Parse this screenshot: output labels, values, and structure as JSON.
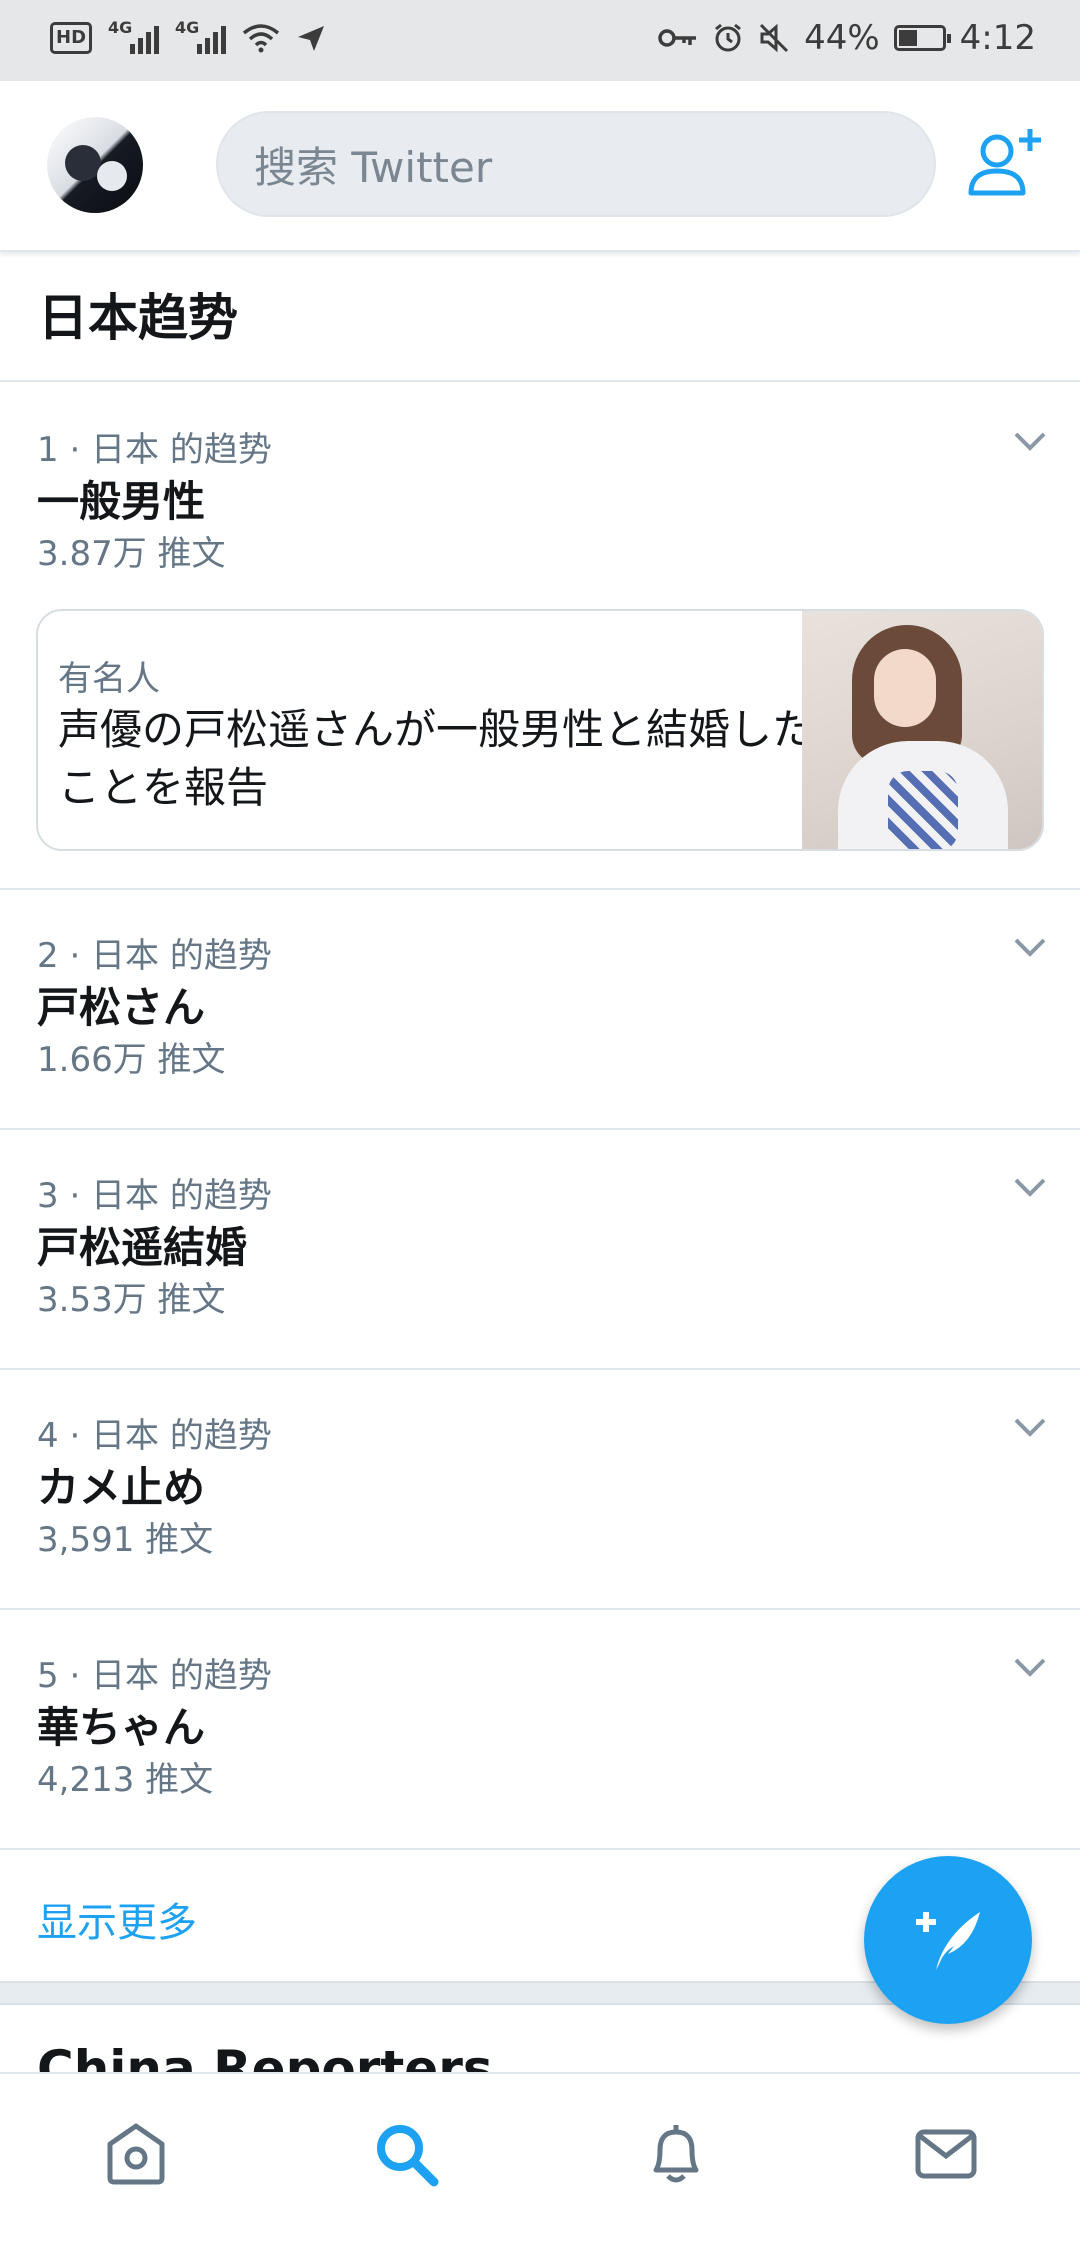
{
  "status_bar": {
    "hd": "HD",
    "signal1": "4G",
    "signal2": "4G",
    "battery_percent": "44%",
    "battery_level": 0.44,
    "time": "4:12"
  },
  "search": {
    "placeholder": "搜索 Twitter"
  },
  "section_title": "日本趋势",
  "trends": [
    {
      "meta": "1 · 日本 的趋势",
      "name": "一般男性",
      "count": "3.87万 推文"
    },
    {
      "meta": "2 · 日本 的趋势",
      "name": "戸松さん",
      "count": "1.66万 推文"
    },
    {
      "meta": "3 · 日本 的趋势",
      "name": "戸松遥結婚",
      "count": "3.53万 推文"
    },
    {
      "meta": "4 · 日本 的趋势",
      "name": "カメ止め",
      "count": "3,591 推文"
    },
    {
      "meta": "5 · 日本 的趋势",
      "name": "華ちゃん",
      "count": "4,213 推文"
    }
  ],
  "card": {
    "category": "有名人",
    "headline": "声優の戸松遥さんが一般男性と結婚したことを報告"
  },
  "show_more": "显示更多",
  "next_section_title": "China Reporters",
  "colors": {
    "accent": "#1da1f2",
    "text": "#14171a",
    "muted": "#657786"
  },
  "icons": [
    "add-user-icon",
    "compose-tweet-icon",
    "home-icon",
    "search-icon",
    "notifications-icon",
    "messages-icon"
  ]
}
